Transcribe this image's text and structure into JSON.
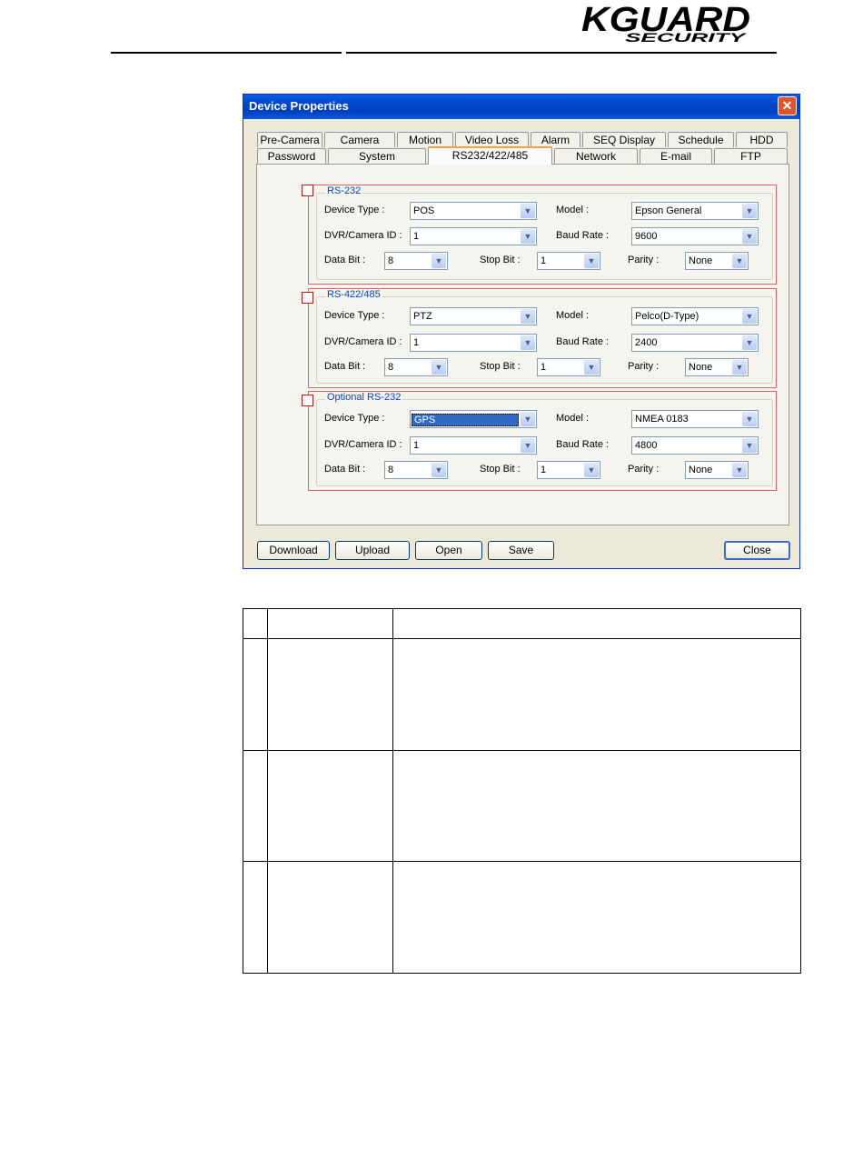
{
  "header": {
    "logo_text_top": "KGUARD",
    "logo_text_bottom": "SECURITY"
  },
  "dialog": {
    "title": "Device Properties",
    "tabs_row1": [
      "Pre-Camera",
      "Camera",
      "Motion",
      "Video Loss",
      "Alarm",
      "SEQ Display",
      "Schedule",
      "HDD"
    ],
    "tabs_row2": [
      "Password",
      "System",
      "RS232/422/485",
      "Network",
      "E-mail",
      "FTP"
    ],
    "active_tab": "RS232/422/485",
    "labels": {
      "device_type": "Device Type :",
      "model": "Model :",
      "dvr_id": "DVR/Camera ID :",
      "baud": "Baud Rate :",
      "data_bit": "Data Bit :",
      "stop_bit": "Stop Bit :",
      "parity": "Parity :"
    },
    "groups": [
      {
        "title": "RS-232",
        "device_type": "POS",
        "model": "Epson General",
        "dvr_id": "1",
        "baud": "9600",
        "data_bit": "8",
        "stop_bit": "1",
        "parity": "None"
      },
      {
        "title": "RS-422/485",
        "device_type": "PTZ",
        "model": "Pelco(D-Type)",
        "dvr_id": "1",
        "baud": "2400",
        "data_bit": "8",
        "stop_bit": "1",
        "parity": "None"
      },
      {
        "title": "Optional RS-232",
        "device_type": "GPS",
        "model": "NMEA 0183",
        "dvr_id": "1",
        "baud": "4800",
        "data_bit": "8",
        "stop_bit": "1",
        "parity": "None"
      }
    ],
    "buttons": {
      "download": "Download",
      "upload": "Upload",
      "open": "Open",
      "save": "Save",
      "close": "Close"
    },
    "close_glyph": "✕"
  },
  "icons": {
    "dropdown": "chevron-down-icon",
    "close": "close-icon"
  },
  "colors": {
    "title_bar": "#0a5ce0",
    "highlight_border": "#e06060",
    "group_title": "#0046d5",
    "tab_accent": "#f3a33b"
  }
}
